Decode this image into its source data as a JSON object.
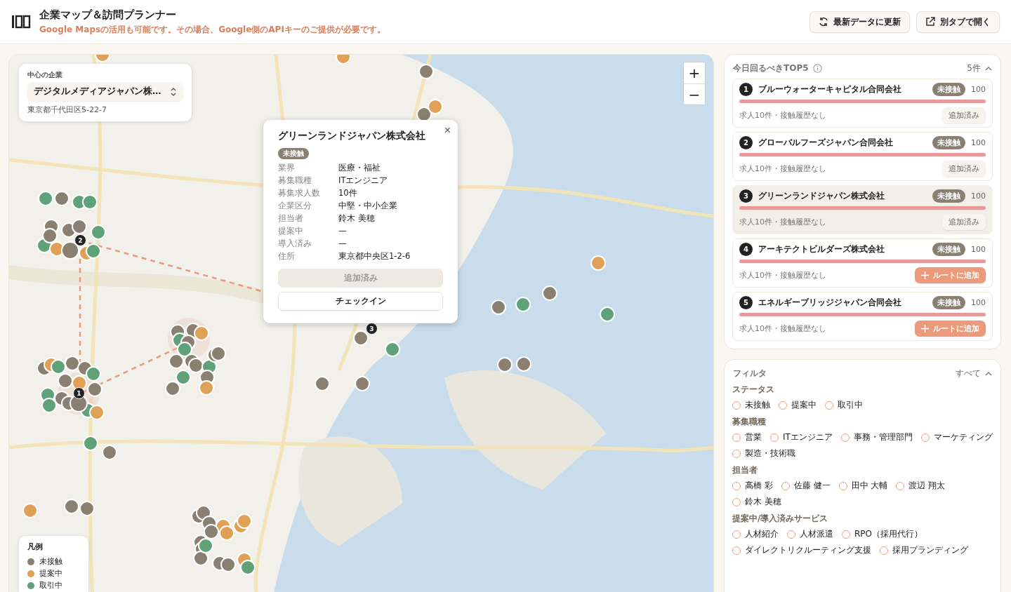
{
  "header": {
    "title": "企業マップ＆訪問プランナー",
    "subtitle": "Google Mapsの活用も可能です。その場合、Google側のAPIキーのご提供が必要です。",
    "buttons": [
      {
        "kind": "refresh",
        "label": "最新データに更新"
      },
      {
        "kind": "external",
        "label": "別タブで開く"
      }
    ]
  },
  "map": {
    "center_company": {
      "label": "中心の企業",
      "value": "デジタルメディアジャパン株…",
      "address": "東京都千代田区5-22-7"
    },
    "zoom_controls": [
      "+",
      "−"
    ],
    "route_markers": [
      "1",
      "2",
      "3"
    ],
    "popup": {
      "close": "×",
      "name": "グリーンランドジャパン株式会社",
      "status": "未接触",
      "fields": [
        {
          "label": "業界",
          "value": "医療・福祉"
        },
        {
          "label": "募集職種",
          "value": "ITエンジニア"
        },
        {
          "label": "募集求人数",
          "value": "10件"
        },
        {
          "label": "企業区分",
          "value": "中堅・中小企業"
        },
        {
          "label": "担当者",
          "value": "鈴木 美穂"
        },
        {
          "label": "提案中",
          "value": "—"
        },
        {
          "label": "導入済み",
          "value": "—"
        },
        {
          "label": "住所",
          "value": "東京都中央区1-2-6"
        }
      ],
      "buttons": [
        {
          "label": "追加済み",
          "disabled": true
        },
        {
          "label": "チェックイン",
          "disabled": false
        }
      ]
    },
    "legend": {
      "title": "凡例",
      "items": [
        {
          "label": "未接触",
          "color": "#8a8072"
        },
        {
          "label": "提案中",
          "color": "#e0a055"
        },
        {
          "label": "取引中",
          "color": "#5fa27a"
        }
      ]
    }
  },
  "top5": {
    "title": "今日回るべきTOP5",
    "count": "5件",
    "expanded": true,
    "items": [
      {
        "rank": "1",
        "name": "ブルーウォーターキャピタル合同会社",
        "status": "未接触",
        "score": "100",
        "level": 1,
        "meta": "求人10件・接触履歴なし",
        "selected": false,
        "action": {
          "kind": "added",
          "label": "追加済み"
        }
      },
      {
        "rank": "2",
        "name": "グローバルフーズジャパン合同会社",
        "status": "未接触",
        "score": "100",
        "level": 1,
        "meta": "求人10件・接触履歴なし",
        "selected": false,
        "action": {
          "kind": "added",
          "label": "追加済み"
        }
      },
      {
        "rank": "3",
        "name": "グリーンランドジャパン株式会社",
        "status": "未接触",
        "score": "100",
        "level": 1,
        "meta": "求人10件・接触履歴なし",
        "selected": true,
        "action": {
          "kind": "added",
          "label": "追加済み"
        }
      },
      {
        "rank": "4",
        "name": "アーキテクトビルダーズ株式会社",
        "status": "未接触",
        "score": "100",
        "level": 1,
        "meta": "求人10件・接触履歴なし",
        "selected": false,
        "action": {
          "kind": "add",
          "label": "ルートに追加"
        }
      },
      {
        "rank": "5",
        "name": "エネルギーブリッジジャパン合同会社",
        "status": "未接触",
        "score": "100",
        "level": 1,
        "meta": "求人10件・接触履歴なし",
        "selected": false,
        "action": {
          "kind": "add",
          "label": "ルートに追加"
        }
      }
    ]
  },
  "filter": {
    "title": "フィルタ",
    "all": "すべて",
    "expanded": true,
    "groups": [
      {
        "title": "ステータス",
        "options": [
          {
            "label": "未接触",
            "checked": false
          },
          {
            "label": "提案中",
            "checked": false
          },
          {
            "label": "取引中",
            "checked": false
          }
        ]
      },
      {
        "title": "募集職種",
        "options": [
          {
            "label": "営業",
            "checked": false
          },
          {
            "label": "ITエンジニア",
            "checked": false
          },
          {
            "label": "事務・管理部門",
            "checked": false
          },
          {
            "label": "マーケティング",
            "checked": false
          },
          {
            "label": "製造・技術職",
            "checked": false
          }
        ]
      },
      {
        "title": "担当者",
        "options": [
          {
            "label": "高橋 彩",
            "checked": false
          },
          {
            "label": "佐藤 健一",
            "checked": false
          },
          {
            "label": "田中 大輔",
            "checked": false
          },
          {
            "label": "渡辺 翔太",
            "checked": false
          },
          {
            "label": "鈴木 美穂",
            "checked": false
          }
        ]
      },
      {
        "title": "提案中/導入済みサービス",
        "options": [
          {
            "label": "人材紹介",
            "checked": false
          },
          {
            "label": "人材派遣",
            "checked": false
          },
          {
            "label": "RPO（採用代行）",
            "checked": false
          },
          {
            "label": "ダイレクトリクルーティング支援",
            "checked": false
          },
          {
            "label": "採用ブランディング",
            "checked": false
          }
        ]
      }
    ]
  }
}
